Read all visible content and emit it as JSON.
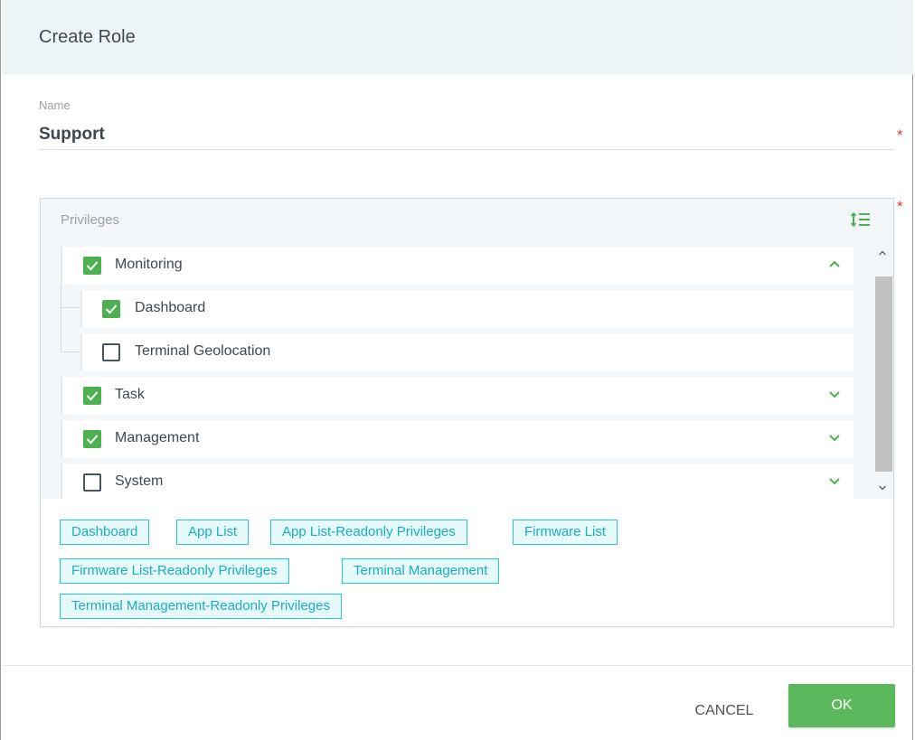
{
  "dialog": {
    "title": "Create Role"
  },
  "name_field": {
    "label": "Name",
    "value": "Support",
    "required_marker": "*"
  },
  "privileges": {
    "title": "Privileges",
    "required_marker": "*",
    "sort_icon": "sort-list-icon",
    "tree": [
      {
        "label": "Monitoring",
        "checked": true,
        "expanded": true,
        "children": [
          {
            "label": "Dashboard",
            "checked": true
          },
          {
            "label": "Terminal Geolocation",
            "checked": false
          }
        ]
      },
      {
        "label": "Task",
        "checked": true,
        "expanded": false
      },
      {
        "label": "Management",
        "checked": true,
        "expanded": false
      },
      {
        "label": "System",
        "checked": false,
        "expanded": false
      }
    ],
    "selected_tags": [
      "Dashboard",
      "App List",
      "App List-Readonly Privileges",
      "Firmware List",
      "Firmware List-Readonly Privileges",
      "Terminal Management",
      "Terminal Management-Readonly Privileges"
    ]
  },
  "footer": {
    "cancel_label": "CANCEL",
    "ok_label": "OK"
  },
  "colors": {
    "accent_green": "#4caf50",
    "tag_cyan": "#26c6da",
    "required_red": "#e53935"
  }
}
